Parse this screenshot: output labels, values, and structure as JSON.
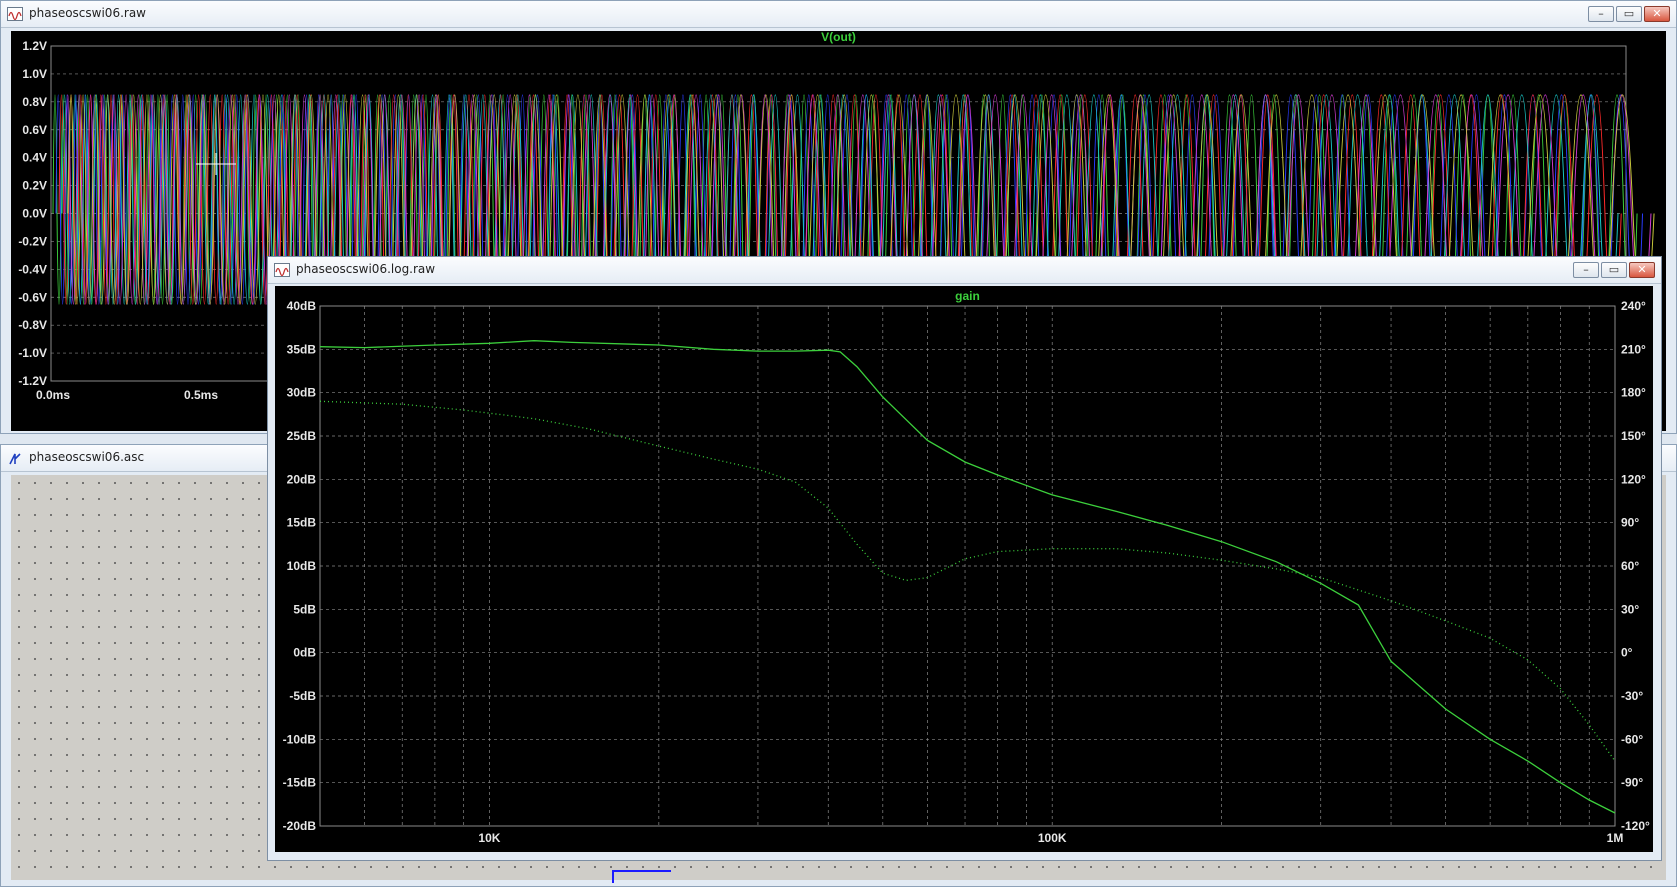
{
  "windows": {
    "transient": {
      "title": "phaseoscswi06.raw"
    },
    "schematic": {
      "title": "phaseoscswi06.asc"
    },
    "ac": {
      "title": "phaseoscswi06.log.raw"
    }
  },
  "window_buttons": {
    "minimize": "–",
    "restore": "▭",
    "close": "✕"
  },
  "colors": {
    "trace_green": "#3ccf3c",
    "title_green": "#3ccf3c",
    "grid": "#8a8a8a",
    "background": "#000000"
  },
  "chart_data": [
    {
      "type": "line",
      "title": "V(out)",
      "y_ticks": [
        "1.2V",
        "1.0V",
        "0.8V",
        "0.6V",
        "0.4V",
        "0.2V",
        "0.0V",
        "-0.2V",
        "-0.4V",
        "-0.6V",
        "-0.8V",
        "-1.0V",
        "-1.2V"
      ],
      "y_values": [
        1.2,
        1.0,
        0.8,
        0.6,
        0.4,
        0.2,
        0.0,
        -0.2,
        -0.4,
        -0.6,
        -0.8,
        -1.0,
        -1.2
      ],
      "x_ticks_visible": [
        "0.0ms",
        "0.5ms"
      ],
      "ylim": [
        -1.2,
        1.2
      ],
      "series_colors": [
        "#3ccf3c",
        "#2a3cff",
        "#ff2a2a",
        "#19c8c8",
        "#d33cd3",
        "#c8c83c"
      ],
      "description_values": {
        "amplitude": 1.0,
        "frequency_sweep": "increasing oscillation period left to right"
      }
    },
    {
      "type": "line",
      "title": "gain",
      "x_scale": "log",
      "xlim": [
        5000,
        1000000
      ],
      "x_ticks": [
        "10K",
        "100K",
        "1M"
      ],
      "x_tick_values": [
        10000,
        100000,
        1000000
      ],
      "y_ticks_left": [
        "40dB",
        "35dB",
        "30dB",
        "25dB",
        "20dB",
        "15dB",
        "10dB",
        "5dB",
        "0dB",
        "-5dB",
        "-10dB",
        "-15dB",
        "-20dB"
      ],
      "y_ticks_right": [
        "240°",
        "210°",
        "180°",
        "150°",
        "120°",
        "90°",
        "60°",
        "30°",
        "0°",
        "-30°",
        "-60°",
        "-90°",
        "-120°"
      ],
      "ylim_left": [
        -20,
        40
      ],
      "ylim_right": [
        -120,
        240
      ],
      "grid": true,
      "series": [
        {
          "axis": "left",
          "style": "solid",
          "x": [
            5000,
            6000,
            8000,
            10000,
            12000,
            14000,
            20000,
            25000,
            30000,
            35000,
            40000,
            42000,
            45000,
            50000,
            60000,
            70000,
            80000,
            100000,
            130000,
            160000,
            200000,
            250000,
            300000,
            350000,
            400000,
            500000,
            600000,
            700000,
            800000,
            900000,
            1000000
          ],
          "y": [
            35.3,
            35.2,
            35.5,
            35.7,
            36.0,
            35.8,
            35.5,
            35.0,
            34.8,
            34.8,
            34.9,
            34.7,
            33.0,
            29.5,
            24.5,
            22.0,
            20.5,
            18.2,
            16.3,
            14.7,
            12.8,
            10.5,
            8.0,
            5.5,
            -1.0,
            -6.5,
            -10.0,
            -12.5,
            -15.0,
            -17.0,
            -18.5
          ]
        },
        {
          "axis": "right",
          "style": "dotted",
          "x": [
            5000,
            7000,
            9000,
            12000,
            15000,
            20000,
            25000,
            30000,
            35000,
            40000,
            45000,
            50000,
            55000,
            60000,
            70000,
            80000,
            100000,
            130000,
            160000,
            200000,
            250000,
            300000,
            400000,
            500000,
            600000,
            700000,
            800000,
            900000,
            1000000
          ],
          "y": [
            174,
            172,
            168,
            162,
            155,
            143,
            134,
            127,
            118,
            100,
            75,
            55,
            50,
            52,
            65,
            70,
            72,
            72,
            69,
            64,
            58,
            52,
            36,
            22,
            10,
            -5,
            -25,
            -50,
            -75
          ]
        }
      ]
    }
  ]
}
